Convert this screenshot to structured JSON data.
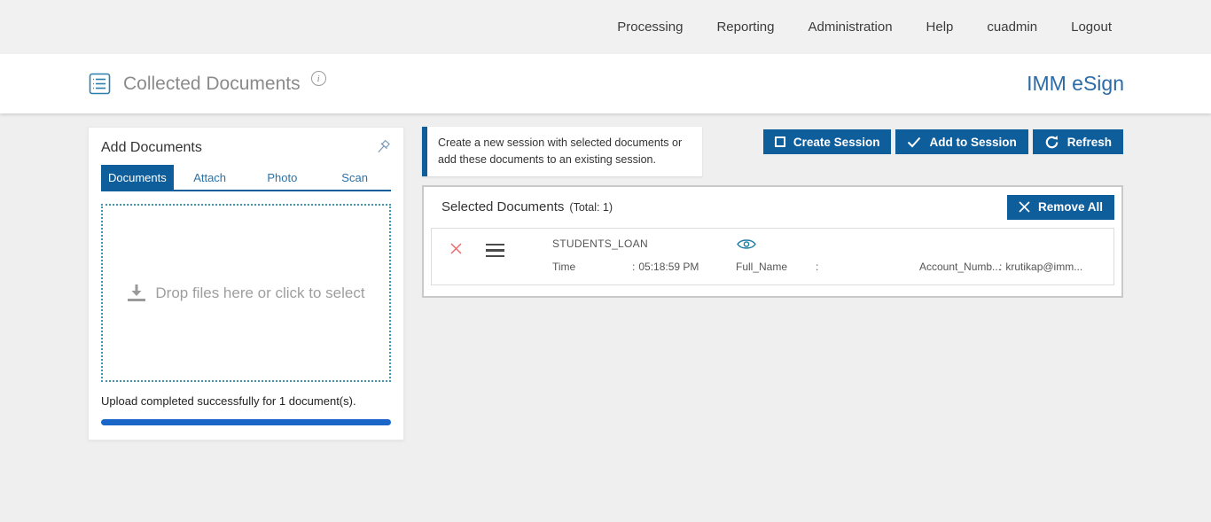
{
  "topnav": {
    "items": [
      "Processing",
      "Reporting",
      "Administration",
      "Help",
      "cuadmin",
      "Logout"
    ]
  },
  "header": {
    "title": "Collected Documents",
    "brand": "IMM eSign"
  },
  "icons": {
    "info": "i"
  },
  "add_documents": {
    "title": "Add Documents",
    "tabs": [
      "Documents",
      "Attach",
      "Photo",
      "Scan"
    ],
    "active_tab": "Documents",
    "dropzone_text": "Drop files here or click to select",
    "status_text": "Upload completed successfully for 1 document(s)."
  },
  "session_info": {
    "message": "Create a new session with selected documents or add these documents to an existing session."
  },
  "actions": {
    "create_session": "Create Session",
    "add_to_session": "Add to Session",
    "refresh": "Refresh"
  },
  "selected_documents": {
    "title": "Selected Documents",
    "total_label": "(Total: 1)",
    "remove_all": "Remove All",
    "rows": [
      {
        "name": "STUDENTS_LOAN",
        "fields": [
          {
            "label": "Time",
            "sep": ":",
            "value": "05:18:59 PM"
          },
          {
            "label": "Full_Name",
            "sep": ":",
            "value": ""
          },
          {
            "label": "Account_Numb...",
            "sep": ":",
            "value": "krutikap@imm..."
          }
        ]
      }
    ]
  },
  "colors": {
    "primary": "#0f5e9c",
    "brand": "#2b6ba6",
    "progress": "#1a66c8",
    "accent_teal": "#3f96ad",
    "danger": "#ef6b6b"
  }
}
